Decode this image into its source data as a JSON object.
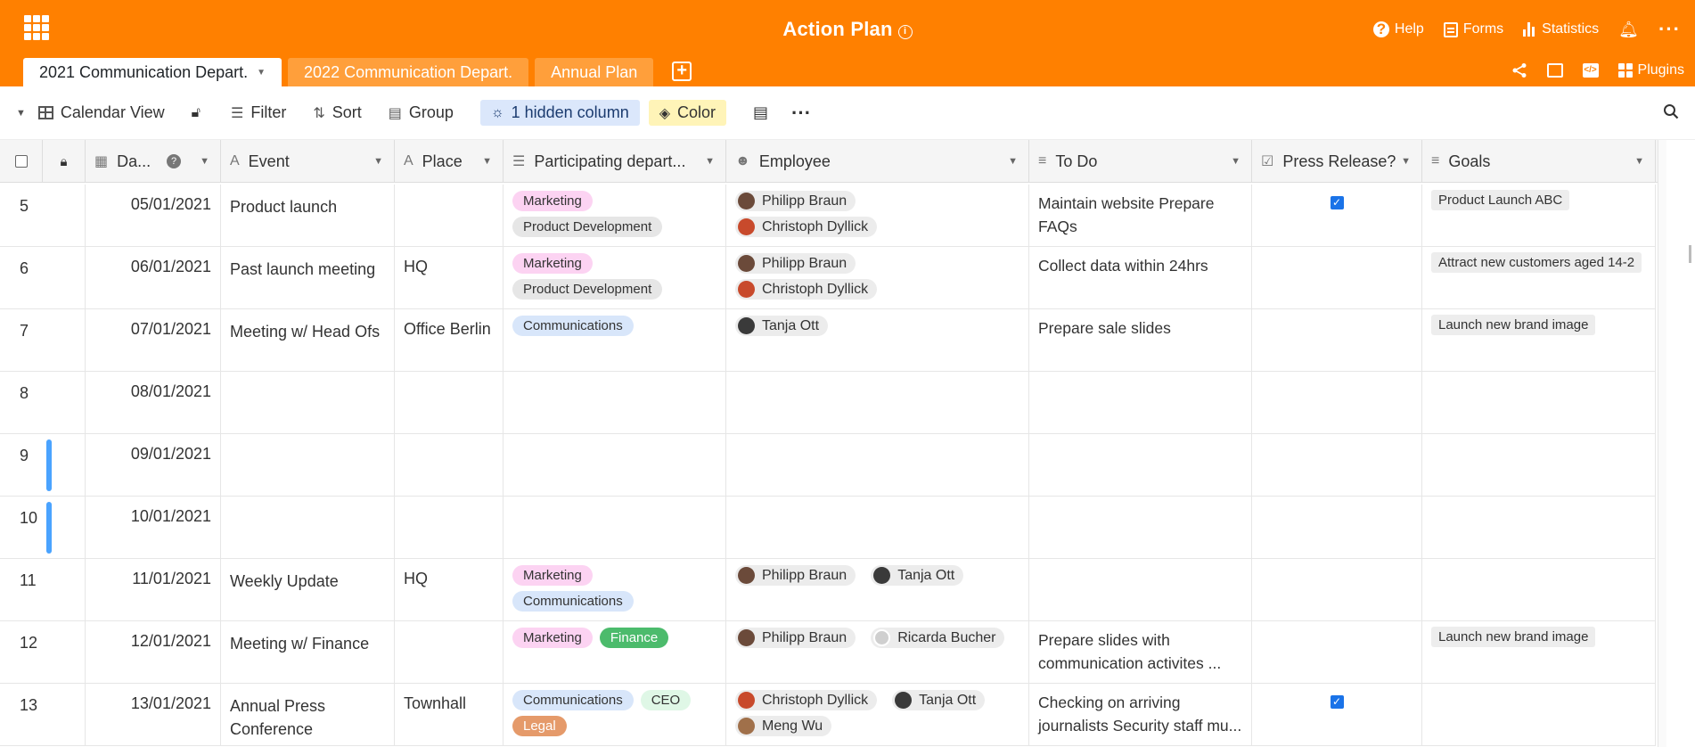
{
  "header": {
    "base_title": "Action Plan",
    "help": "Help",
    "forms": "Forms",
    "statistics": "Statistics",
    "plugins": "Plugins",
    "accent": "#ff8000"
  },
  "tabs": [
    {
      "label": "2021 Communication Depart."
    },
    {
      "label": "2022 Communication Depart."
    },
    {
      "label": "Annual Plan"
    }
  ],
  "toolbar": {
    "view": "Calendar View",
    "filter": "Filter",
    "sort": "Sort",
    "group": "Group",
    "hidden": "1 hidden column",
    "color": "Color"
  },
  "columns": {
    "date": "Da...",
    "event": "Event",
    "place": "Place",
    "dept": "Participating depart...",
    "employee": "Employee",
    "todo": "To Do",
    "press": "Press Release?",
    "goals": "Goals"
  },
  "rows": [
    {
      "num": "5",
      "date": "05/01/2021",
      "event": "Product launch",
      "place": "",
      "todo": "Maintain website Prepare FAQs",
      "press": true,
      "goal": "Product Launch ABC"
    },
    {
      "num": "6",
      "date": "06/01/2021",
      "event": "Past launch meeting",
      "place": "HQ",
      "todo": "Collect data within 24hrs",
      "press": false,
      "goal": "Attract new customers aged 14-2"
    },
    {
      "num": "7",
      "date": "07/01/2021",
      "event": "Meeting w/ Head Ofs",
      "place": "Office Berlin",
      "todo": "Prepare sale slides",
      "press": false,
      "goal": "Launch new brand image"
    },
    {
      "num": "8",
      "date": "08/01/2021",
      "event": "",
      "place": "",
      "todo": "",
      "press": false,
      "goal": ""
    },
    {
      "num": "9",
      "date": "09/01/2021",
      "event": "",
      "place": "",
      "todo": "",
      "press": false,
      "goal": ""
    },
    {
      "num": "10",
      "date": "10/01/2021",
      "event": "",
      "place": "",
      "todo": "",
      "press": false,
      "goal": ""
    },
    {
      "num": "11",
      "date": "11/01/2021",
      "event": "Weekly Update",
      "place": "HQ",
      "todo": "",
      "press": false,
      "goal": ""
    },
    {
      "num": "12",
      "date": "12/01/2021",
      "event": "Meeting w/ Finance",
      "place": "",
      "todo": "Prepare slides with communication activites ...",
      "press": false,
      "goal": "Launch new brand image"
    },
    {
      "num": "13",
      "date": "13/01/2021",
      "event": "Annual Press Conference",
      "place": "Townhall",
      "todo": "Checking on arriving journalists Security staff mu...",
      "press": true,
      "goal": ""
    }
  ],
  "tags": {
    "marketing": "Marketing",
    "product_dev": "Product Development",
    "communications": "Communications",
    "finance": "Finance",
    "ceo": "CEO",
    "legal": "Legal"
  },
  "people": {
    "philipp": "Philipp Braun",
    "christoph": "Christoph Dyllick",
    "tanja": "Tanja Ott",
    "ricarda": "Ricarda Bucher",
    "meng": "Meng Wu"
  }
}
